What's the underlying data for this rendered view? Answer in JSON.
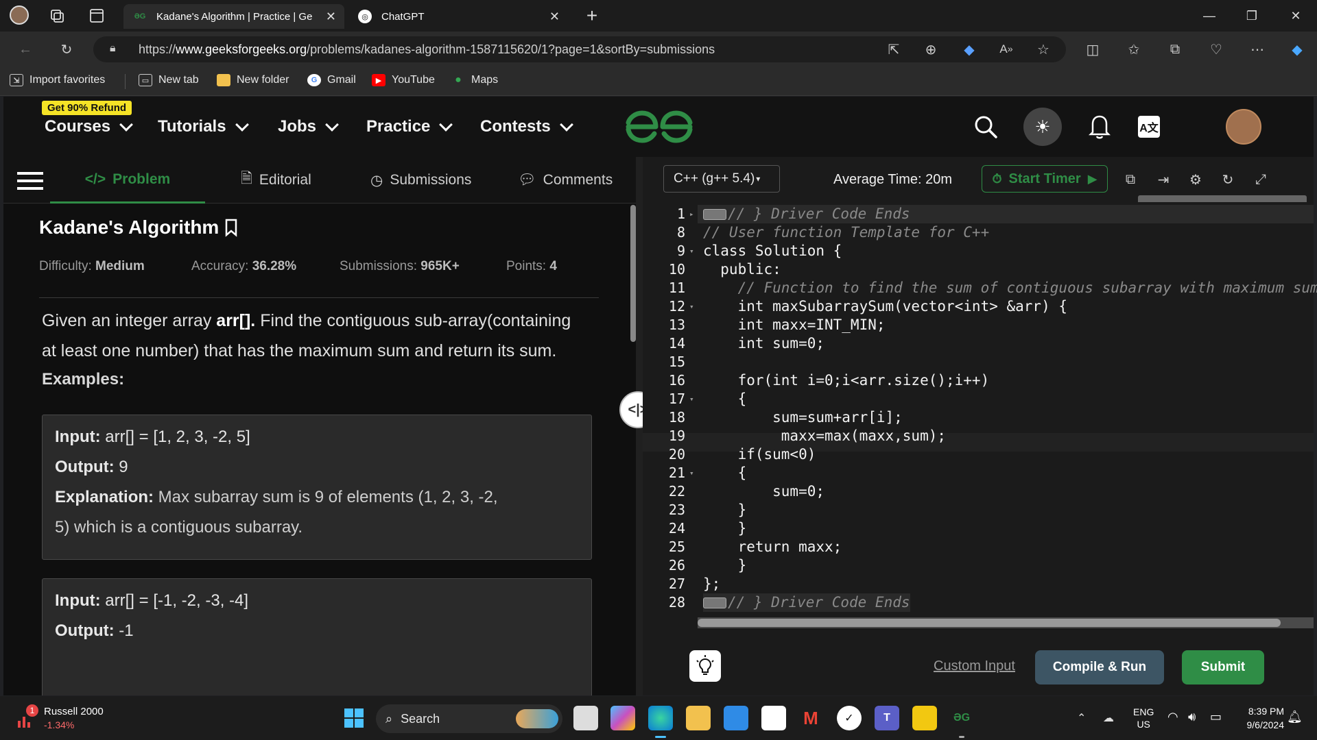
{
  "browser": {
    "tabs": [
      {
        "title": "Kadane's Algorithm | Practice | Ge",
        "favicon": "gfg-icon",
        "active": true
      },
      {
        "title": "ChatGPT",
        "favicon": "chatgpt-icon",
        "active": false
      }
    ],
    "url_prefix": "https://",
    "url_host": "www.geeksforgeeks.org",
    "url_path": "/problems/kadanes-algorithm-1587115620/1?page=1&sortBy=submissions"
  },
  "favorites": [
    {
      "label": "Import favorites",
      "icon": "import-icon"
    },
    {
      "label": "New tab",
      "icon": "newtab-icon"
    },
    {
      "label": "New folder",
      "icon": "folder-icon"
    },
    {
      "label": "Gmail",
      "icon": "google-icon"
    },
    {
      "label": "YouTube",
      "icon": "youtube-icon"
    },
    {
      "label": "Maps",
      "icon": "maps-icon"
    }
  ],
  "gfg_nav": {
    "refund_badge": "Get 90% Refund",
    "items": [
      "Courses",
      "Tutorials",
      "Jobs",
      "Practice",
      "Contests"
    ]
  },
  "problem_tabs": [
    "Problem",
    "Editorial",
    "Submissions",
    "Comments"
  ],
  "problem": {
    "title": "Kadane's Algorithm",
    "difficulty_label": "Difficulty: ",
    "difficulty": "Medium",
    "accuracy_label": "Accuracy: ",
    "accuracy": "36.28%",
    "submissions_label": "Submissions: ",
    "submissions": "965K+",
    "points_label": "Points: ",
    "points": "4",
    "statement_1": "Given an integer array ",
    "statement_bold": "arr[].",
    "statement_2": " Find the contiguous sub-array(containing",
    "statement_3": "at least one number) that has the maximum sum and return its sum.",
    "examples_heading": "Examples:",
    "example1": {
      "input_label": "Input:",
      "input": " arr[] = [1, 2, 3, -2, 5]",
      "output_label": "Output:",
      "output": " 9",
      "explanation_label": "Explanation:",
      "explanation_1": " Max subarray sum is 9 of elements (1, 2, 3, -2,",
      "explanation_2": "5) which is a contiguous subarray."
    },
    "example2": {
      "input_label": "Input:",
      "input": " arr[] = [-1, -2, -3, -4]",
      "output_label": "Output:",
      "output": " -1"
    }
  },
  "editor": {
    "language": "C++ (g++ 5.4)",
    "average_time": "Average Time: 20m",
    "start_timer": "Start Timer",
    "line_numbers": [
      "1",
      "8",
      "9",
      "10",
      "11",
      "12",
      "13",
      "14",
      "15",
      "16",
      "17",
      "18",
      "19",
      "20",
      "21",
      "22",
      "23",
      "24",
      "25",
      "26",
      "27",
      "28"
    ],
    "lines": [
      "// } Driver Code Ends",
      "// User function Template for C++",
      "class Solution {",
      "  public:",
      "    // Function to find the sum of contiguous subarray with maximum sum.",
      "    int maxSubarraySum(vector<int> &arr) {",
      "    int maxx=INT_MIN;",
      "    int sum=0;",
      "",
      "    for(int i=0;i<arr.size();i++)",
      "    {",
      "        sum=sum+arr[i];",
      "         maxx=max(maxx,sum);",
      "    if(sum<0)",
      "    {",
      "        sum=0;",
      "    }",
      "    }",
      "    return maxx;",
      "    }",
      "};",
      "// } Driver Code Ends"
    ],
    "custom_input": "Custom Input",
    "compile_run": "Compile & Run",
    "submit": "Submit"
  },
  "taskbar": {
    "stock_name": "Russell 2000",
    "stock_change": "-1.34%",
    "stock_badge": "1",
    "search_placeholder": "Search",
    "lang_1": "ENG",
    "lang_2": "US",
    "time": "8:39 PM",
    "date": "9/6/2024"
  },
  "colors": {
    "gfg_green": "#2f8d46",
    "code_keyword": "#ff6b8b",
    "comment": "#8a8a8a"
  }
}
